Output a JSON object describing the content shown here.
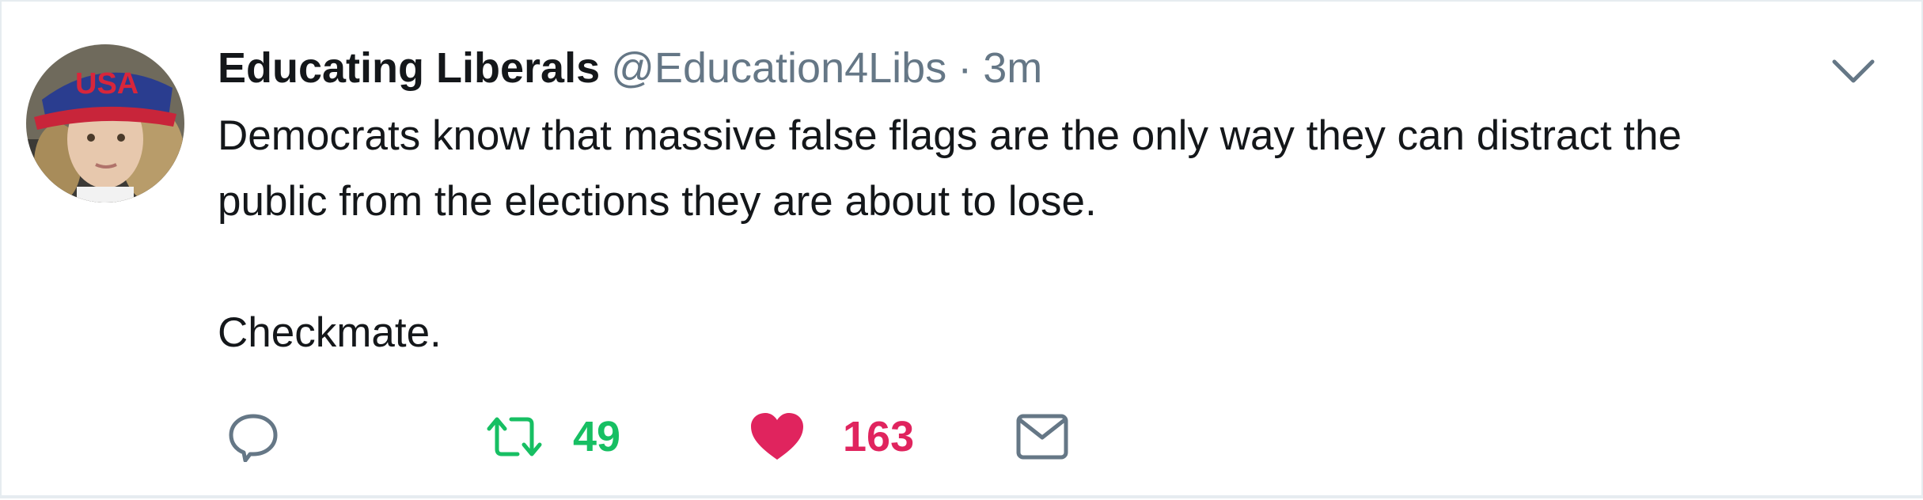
{
  "tweet": {
    "display_name": "Educating Liberals",
    "handle": "@Education4Libs",
    "separator": "·",
    "time": "3m",
    "text_line1": "Democrats know that massive false flags are the only way they can distract the",
    "text_line2": "public from the elections they are about to lose.",
    "text_para2": "Checkmate."
  },
  "actions": {
    "retweet_count": "49",
    "like_count": "163"
  },
  "colors": {
    "text": "#14171a",
    "secondary": "#657786",
    "retweet": "#17bf63",
    "like": "#e0245e",
    "border": "#e6ecf0"
  },
  "icons": {
    "reply": "reply-icon",
    "retweet": "retweet-icon",
    "like": "heart-icon",
    "dm": "envelope-icon",
    "caret": "chevron-down-icon"
  }
}
